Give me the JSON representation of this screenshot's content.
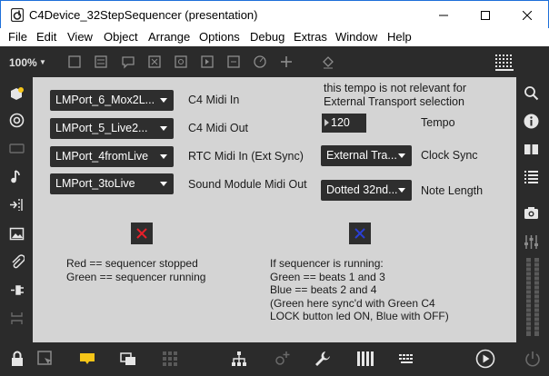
{
  "window": {
    "title": "C4Device_32StepSequencer (presentation)"
  },
  "menu": {
    "items": [
      "File",
      "Edit",
      "View",
      "Object",
      "Arrange",
      "Options",
      "Debug",
      "Extras",
      "Window",
      "Help"
    ]
  },
  "toolbar": {
    "zoom": "100%"
  },
  "panel": {
    "ports": [
      {
        "menu": "LMPort_6_Mox2L...",
        "label": "C4 Midi In"
      },
      {
        "menu": "LMPort_5_Live2...",
        "label": "C4 Midi Out"
      },
      {
        "menu": "LMPort_4fromLive",
        "label": "RTC Midi In (Ext Sync)"
      },
      {
        "menu": "LMPort_3toLive",
        "label": "Sound Module Midi Out"
      }
    ],
    "tempo_note": [
      "this tempo is not relevant for",
      "External Transport selection"
    ],
    "tempo_value": "120",
    "tempo_label": "Tempo",
    "clock_sync_menu": "External Tra...",
    "clock_sync_label": "Clock Sync",
    "note_length_menu": "Dotted 32nd...",
    "note_length_label": "Note Length",
    "status_left": [
      "Red == sequencer stopped",
      "Green == sequencer running"
    ],
    "status_right": [
      "If sequencer is running:",
      "Green == beats 1 and 3",
      "Blue == beats 2 and 4",
      "(Green here sync'd with Green C4",
      "LOCK button led ON, Blue with OFF)"
    ]
  },
  "colors": {
    "led_red": "#e8202a",
    "led_blue": "#2a3fd6",
    "accent_yellow": "#f5c518"
  },
  "icons": {
    "left_sidebar": [
      "cube-icon",
      "target-icon",
      "comment-icon",
      "music-note-icon",
      "arrow-in-icon",
      "image-icon",
      "paperclip-icon",
      "plug-icon",
      "disconnect-icon"
    ],
    "right_sidebar": [
      "search-icon",
      "info-icon",
      "book-icon",
      "list-icon",
      "camera-icon",
      "sliders-icon",
      "level-meter-icon"
    ],
    "bottom": [
      "lock-icon",
      "select-icon",
      "comment-icon",
      "windows-icon",
      "grid-icon",
      "hierarchy-icon",
      "patch-add-icon",
      "wrench-icon",
      "piano-icon",
      "keyboard-icon",
      "play-icon",
      "power-icon"
    ]
  }
}
